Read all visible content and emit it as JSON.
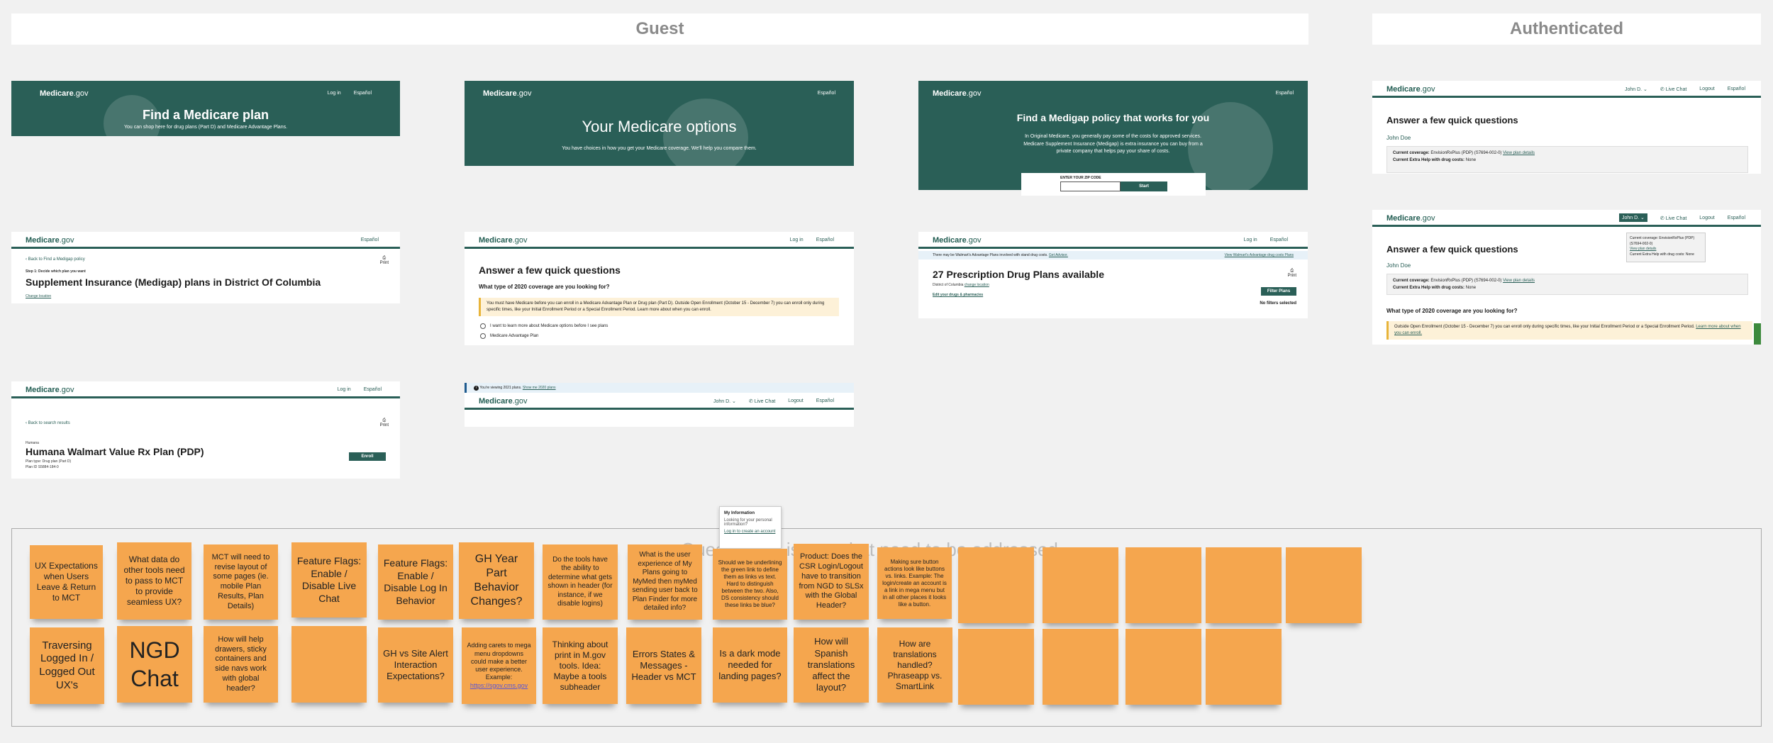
{
  "headers": {
    "guest": "Guest",
    "authenticated": "Authenticated"
  },
  "logo": {
    "brand": "Medicare",
    ".gov": ".gov",
    "suffix": ".gov"
  },
  "nav": {
    "login": "Log in",
    "espanol": "Español",
    "login_alt": "Log in",
    "login_short": "Log In",
    "user": "John D.",
    "live_chat": "Live Chat",
    "logout": "Logout"
  },
  "cards": {
    "find_plan": {
      "title": "Find a Medicare plan",
      "sub": "You can shop here for drug plans (Part D) and Medicare Advantage Plans."
    },
    "options": {
      "title": "Your Medicare options",
      "sub": "You have choices in how you get your Medicare coverage. We'll help you compare them."
    },
    "medigap": {
      "title": "Find a Medigap policy that works for you",
      "sub": "In Original Medicare, you generally pay some of the costs for approved services. Medicare Supplement Insurance (Medigap) is extra insurance you can buy from a private company that helps pay your share of costs.",
      "zip_label": "ENTER YOUR ZIP CODE",
      "start": "Start"
    },
    "supplement": {
      "back": "Back to Find a Medigap policy",
      "step": "Step 1: Decide which plan you want",
      "title": "Supplement Insurance (Medigap) plans in District Of Columbia",
      "change": "Change location",
      "print": "Print"
    },
    "quick": {
      "title": "Answer a few quick questions",
      "question": "What type of 2020 coverage are you looking for?",
      "banner": "You must have Medicare before you can enroll in a Medicare Advantage Plan or Drug plan (Part D). Outside Open Enrollment (October 15 - December 7) you can enroll only during specific times, like your Initial Enrollment Period or a Special Enrollment Period. Learn more about when you can enroll.",
      "opt1": "I want to learn more about Medicare options before I see plans",
      "opt2": "Medicare Advantage Plan"
    },
    "pdp": {
      "notice": "There may be Walmart's Advantage Plans involved with stand drug costs.",
      "notice_link": "Get Advisor.",
      "notice_right": "View Walmart's Advantage drug costs Plans",
      "title": "27 Prescription Drug Plans available",
      "loc": "District of Columbia",
      "change": "change location",
      "edit": "Edit your drugs & pharmacies",
      "filter": "Filter Plans",
      "nofilter": "No filters selected",
      "print": "Print"
    },
    "humana": {
      "back": "Back to search results",
      "brand": "Humana",
      "title": "Humana Walmart Value Rx Plan (PDP)",
      "type": "Plan type: Drug plan (Part D)",
      "id": "Plan ID S5884-184-0",
      "enroll": "Enroll",
      "print": "Print"
    },
    "viewing": {
      "notice": "You're viewing 2021 plans.",
      "link": "Show me 2020 plans"
    },
    "auth1": {
      "title": "Answer a few quick questions",
      "name": "John Doe",
      "cov_label": "Current coverage:",
      "cov": "EnvisionRxPlus (PDP) (S7694-002-0)",
      "cov_link": "View plan details",
      "extra_label": "Current Extra Help with drug costs:",
      "extra": "None"
    },
    "auth2": {
      "title": "Answer a few quick questions",
      "name": "John Doe",
      "question": "What type of 2020 coverage are you looking for?",
      "banner": "Outside Open Enrollment (October 15 - December 7) you can enroll only during specific times, like your Initial Enrollment Period or a Special Enrollment Period.",
      "banner_link": "Learn more about when you can enroll.",
      "dd_cov": "Current coverage: EnvisionRxPlus (PDP) (S7694-002-0)",
      "dd_link": "View plan details",
      "dd_extra": "Current Extra Help with drug costs: None"
    }
  },
  "popover": {
    "title": "My Information",
    "text": "Looking for your personal information?",
    "link": "Log in to create an account"
  },
  "board_title": "Questions & issues that need to be addressed",
  "stickies": {
    "s1": "UX Expectations when Users Leave & Return to MCT",
    "s2": "What data do other tools need to pass to MCT to provide seamless UX?",
    "s3": "MCT will need to revise layout of some pages (ie. mobile Plan Results, Plan Details)",
    "s4": "Feature Flags: Enable / Disable Live Chat",
    "s5": "Feature Flags: Enable / Disable Log In Behavior",
    "s6": "GH Year Part Behavior Changes?",
    "s7": "Do the tools have the ability to determine what gets shown in header (for instance, if we disable logins)",
    "s8": "What is the user experience of My Plans going to MyMed then myMed sending user back to Plan Finder for more detailed info?",
    "s9": "Should we be underlining the green link to define them as links vs text. Hard to distinguish between the two. Also, DS consistency should these links be blue?",
    "s10": "Product: Does the CSR Login/Logout have to transition from NGD to SLSx with the Global Header?",
    "s11": "Making sure button actions look like buttons vs. links. Example: The login/create an account is a link in mega menu but in all other places it looks like a button.",
    "s12": "Traversing Logged In / Logged Out UX's",
    "s13": "NGD Chat",
    "s14": "How will help drawers, sticky containers and side navs work with global header?",
    "s15": "GH vs Site Alert Interaction Expectations?",
    "s16": "Adding carets to mega menu dropdowns could make a better user experience. Example:",
    "s16_link": "https://sgov.cms.gov",
    "s17": "Thinking about print in M.gov tools. Idea: Maybe a tools subheader",
    "s18": "Errors States & Messages - Header vs MCT",
    "s19": "Is a dark mode needed for landing pages?",
    "s20": "How will Spanish translations affect the layout?",
    "s21": "How are translations handled? Phraseapp vs. SmartLink"
  },
  "colors": {
    "brand_green": "#2a5f57",
    "sticky": "#f5a64e",
    "banner": "#fdf1d8"
  }
}
